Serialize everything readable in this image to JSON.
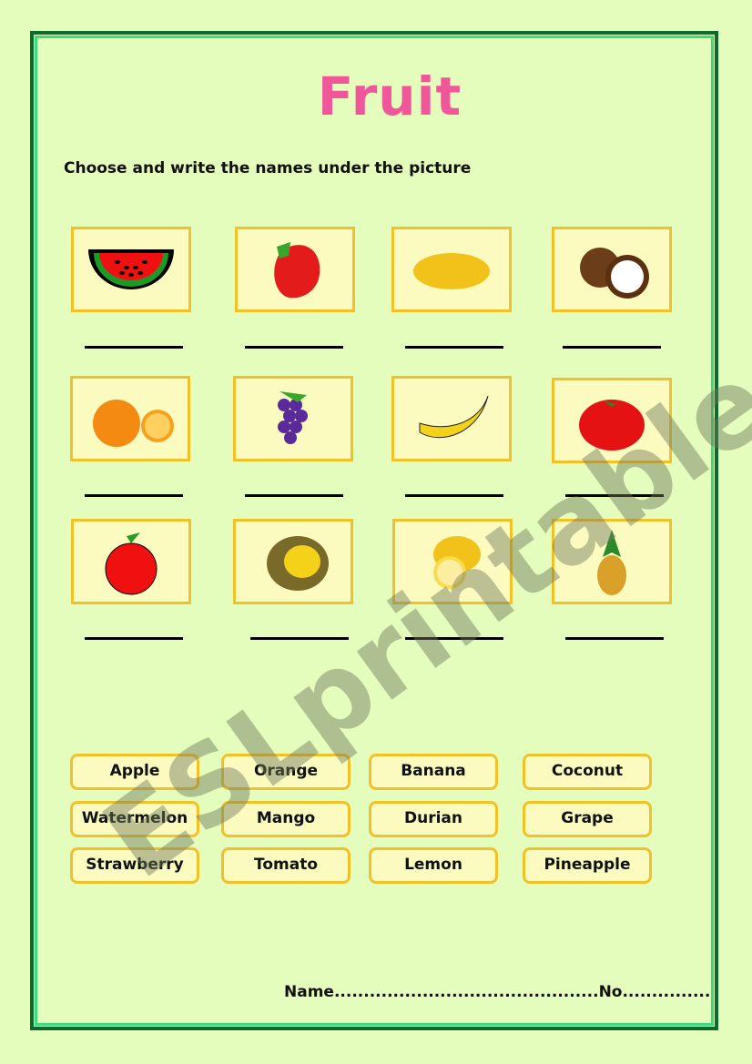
{
  "title": "Fruit",
  "instruction": "Choose and write the names under the picture",
  "pictures": [
    {
      "icon": "watermelon-icon"
    },
    {
      "icon": "strawberry-icon"
    },
    {
      "icon": "mango-icon"
    },
    {
      "icon": "coconut-icon"
    },
    {
      "icon": "orange-icon"
    },
    {
      "icon": "grape-icon"
    },
    {
      "icon": "banana-icon"
    },
    {
      "icon": "tomato-icon"
    },
    {
      "icon": "apple-icon"
    },
    {
      "icon": "durian-icon"
    },
    {
      "icon": "lemon-icon"
    },
    {
      "icon": "pineapple-icon"
    }
  ],
  "word_bank": [
    "Apple",
    "Orange",
    "Banana",
    "Coconut",
    "Watermelon",
    "Mango",
    "Durian",
    "Grape",
    "Strawberry",
    "Tomato",
    "Lemon",
    "Pineapple"
  ],
  "footer": {
    "name_label": "Name.............................................",
    "no_label": "No..............."
  },
  "watermark": "ESLprintables.com",
  "colors": {
    "background": "#e4fcbc",
    "title": "#f0569a",
    "box_border": "#f2c12a",
    "box_fill": "#fbfbc0",
    "frame_outer": "#0a6b2a",
    "frame_inner": "#3ddc7a"
  }
}
